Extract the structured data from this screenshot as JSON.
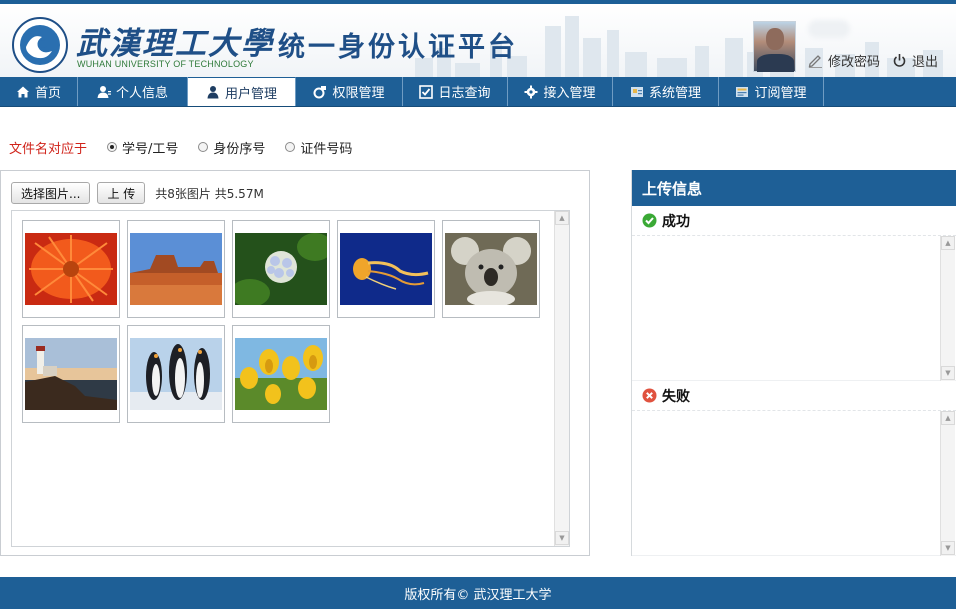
{
  "header": {
    "university_cn": "武漢理工大學",
    "university_en": "WUHAN UNIVERSITY OF TECHNOLOGY",
    "system_title": "统一身份认证平台",
    "change_password": "修改密码",
    "logout": "退出"
  },
  "nav": {
    "items": [
      {
        "label": "首页",
        "icon": "home-icon"
      },
      {
        "label": "个人信息",
        "icon": "person-icon"
      },
      {
        "label": "用户管理",
        "icon": "user-icon",
        "active": true
      },
      {
        "label": "权限管理",
        "icon": "permission-icon"
      },
      {
        "label": "日志查询",
        "icon": "log-icon"
      },
      {
        "label": "接入管理",
        "icon": "gear-icon"
      },
      {
        "label": "系统管理",
        "icon": "system-icon"
      },
      {
        "label": "订阅管理",
        "icon": "subscribe-icon"
      }
    ]
  },
  "filename_option": {
    "label": "文件名对应于",
    "options": [
      "学号/工号",
      "身份序号",
      "证件号码"
    ],
    "selected": "学号/工号"
  },
  "upload": {
    "select_button": "选择图片...",
    "upload_button": "上 传",
    "summary": "共8张图片 共5.57M",
    "thumbnails": [
      "chrysanthemum",
      "desert",
      "hydrangeas",
      "jellyfish",
      "koala",
      "lighthouse",
      "penguins",
      "tulips"
    ]
  },
  "info": {
    "title": "上传信息",
    "success_label": "成功",
    "fail_label": "失败"
  },
  "footer": {
    "copyright": "版权所有© 武汉理工大学"
  },
  "colors": {
    "primary": "#1e5f96",
    "warning_label": "#d0231a",
    "success": "#3aa935",
    "fail": "#e0523f"
  }
}
